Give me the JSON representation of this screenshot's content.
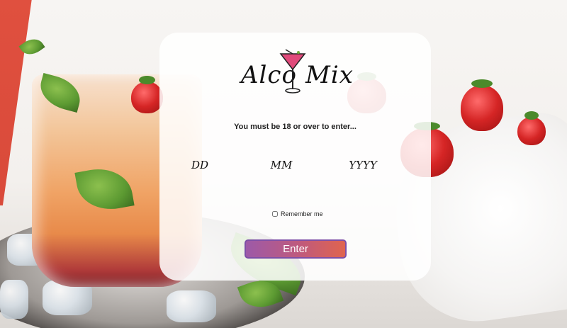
{
  "brand": {
    "left": "Alco",
    "right": "Mix"
  },
  "age_gate": {
    "message": "You must be 18 or over to enter...",
    "day_placeholder": "DD",
    "month_placeholder": "MM",
    "year_placeholder": "YYYY",
    "remember_label": "Remember me",
    "enter_label": "Enter"
  },
  "colors": {
    "button_gradient_start": "#9d5aa8",
    "button_gradient_end": "#e0644e",
    "accent_stripe": "#e0503f"
  },
  "icons": {
    "logo": "cocktail-glass-icon"
  }
}
